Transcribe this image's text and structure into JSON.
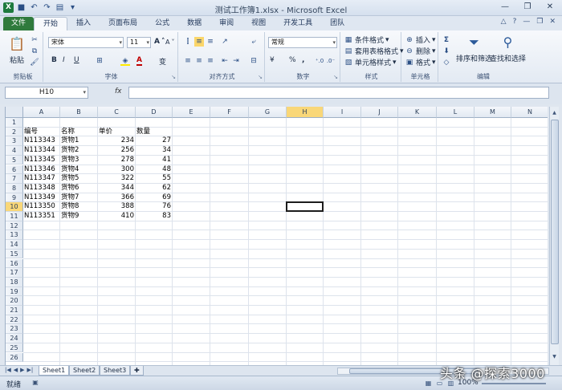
{
  "window": {
    "title": "测试工作簿1.xlsx - Microsoft Excel",
    "qat_icons": [
      "excel-icon",
      "save-icon",
      "undo-icon",
      "redo-icon",
      "quick-access-dropdown-icon"
    ],
    "controls": [
      "minimize",
      "restore",
      "close"
    ]
  },
  "tabs": {
    "file": "文件",
    "items": [
      "开始",
      "插入",
      "页面布局",
      "公式",
      "数据",
      "审阅",
      "视图",
      "开发工具",
      "团队"
    ],
    "active": "开始"
  },
  "ribbon": {
    "clipboard": {
      "label": "剪贴板",
      "paste": "粘贴"
    },
    "font": {
      "label": "字体",
      "name": "宋体",
      "size": "11",
      "bold": "B",
      "italic": "I",
      "underline": "U",
      "grow": "A",
      "shrink": "A",
      "font_color": "A",
      "wen": "变"
    },
    "alignment": {
      "label": "对齐方式"
    },
    "number": {
      "label": "数字",
      "format": "常规",
      "percent": "%",
      "comma": ",",
      "currency": "¥"
    },
    "styles": {
      "label": "样式",
      "cond": "条件格式",
      "table": "套用表格格式",
      "cell": "单元格样式"
    },
    "cells": {
      "label": "单元格",
      "insert": "插入",
      "delete": "删除",
      "format": "格式"
    },
    "editing": {
      "label": "编辑",
      "sort": "排序和筛选",
      "find": "查找和选择"
    }
  },
  "formula_bar": {
    "name_box": "H10",
    "fx": "fx",
    "formula": ""
  },
  "grid": {
    "columns": [
      "A",
      "B",
      "C",
      "D",
      "E",
      "F",
      "G",
      "H",
      "I",
      "J",
      "K",
      "L",
      "M",
      "N"
    ],
    "selected_column": "H",
    "selected_row": "10",
    "rows": [
      "1",
      "2",
      "3",
      "4",
      "5",
      "6",
      "7",
      "8",
      "9",
      "10",
      "11",
      "12",
      "13",
      "14",
      "15",
      "16",
      "17",
      "18",
      "19",
      "20",
      "21",
      "22",
      "23",
      "24",
      "25",
      "26"
    ],
    "header": [
      "编号",
      "名称",
      "单价",
      "数量"
    ],
    "data": [
      [
        "N113343",
        "货物1",
        "234",
        "27"
      ],
      [
        "N113344",
        "货物2",
        "256",
        "34"
      ],
      [
        "N113345",
        "货物3",
        "278",
        "41"
      ],
      [
        "N113346",
        "货物4",
        "300",
        "48"
      ],
      [
        "N113347",
        "货物5",
        "322",
        "55"
      ],
      [
        "N113348",
        "货物6",
        "344",
        "62"
      ],
      [
        "N113349",
        "货物7",
        "366",
        "69"
      ],
      [
        "N113350",
        "货物8",
        "388",
        "76"
      ],
      [
        "N113351",
        "货物9",
        "410",
        "83"
      ]
    ]
  },
  "sheets": {
    "tabs": [
      "Sheet1",
      "Sheet2",
      "Sheet3"
    ],
    "active": "Sheet1"
  },
  "status": {
    "ready": "就绪",
    "zoom": "100%"
  },
  "watermark": "头条 @探索3000"
}
